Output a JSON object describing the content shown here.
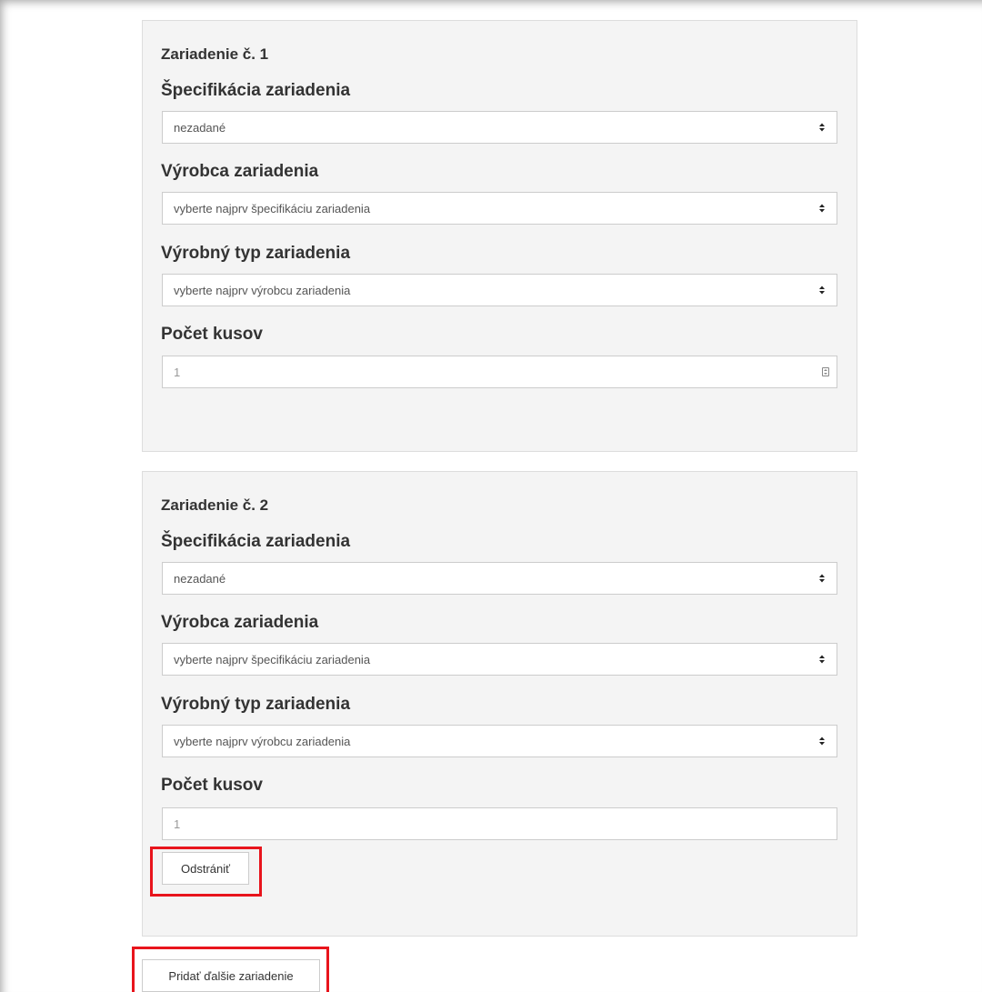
{
  "devices": [
    {
      "title": "Zariadenie č. 1",
      "spec_label": "Špecifikácia zariadenia",
      "spec_value": "nezadané",
      "maker_label": "Výrobca zariadenia",
      "maker_value": "vyberte najprv špecifikáciu zariadenia",
      "type_label": "Výrobný typ zariadenia",
      "type_value": "vyberte najprv výrobcu zariadenia",
      "count_label": "Počet kusov",
      "count_value": "1"
    },
    {
      "title": "Zariadenie č. 2",
      "spec_label": "Špecifikácia zariadenia",
      "spec_value": "nezadané",
      "maker_label": "Výrobca zariadenia",
      "maker_value": "vyberte najprv špecifikáciu zariadenia",
      "type_label": "Výrobný typ zariadenia",
      "type_value": "vyberte najprv výrobcu zariadenia",
      "count_label": "Počet kusov",
      "count_value": "1",
      "remove_label": "Odstrániť"
    }
  ],
  "add_button_label": "Pridať ďalšie zariadenie",
  "colors": {
    "highlight": "#e8141c",
    "panel_bg": "#f4f4f4",
    "border": "#cccccc"
  }
}
